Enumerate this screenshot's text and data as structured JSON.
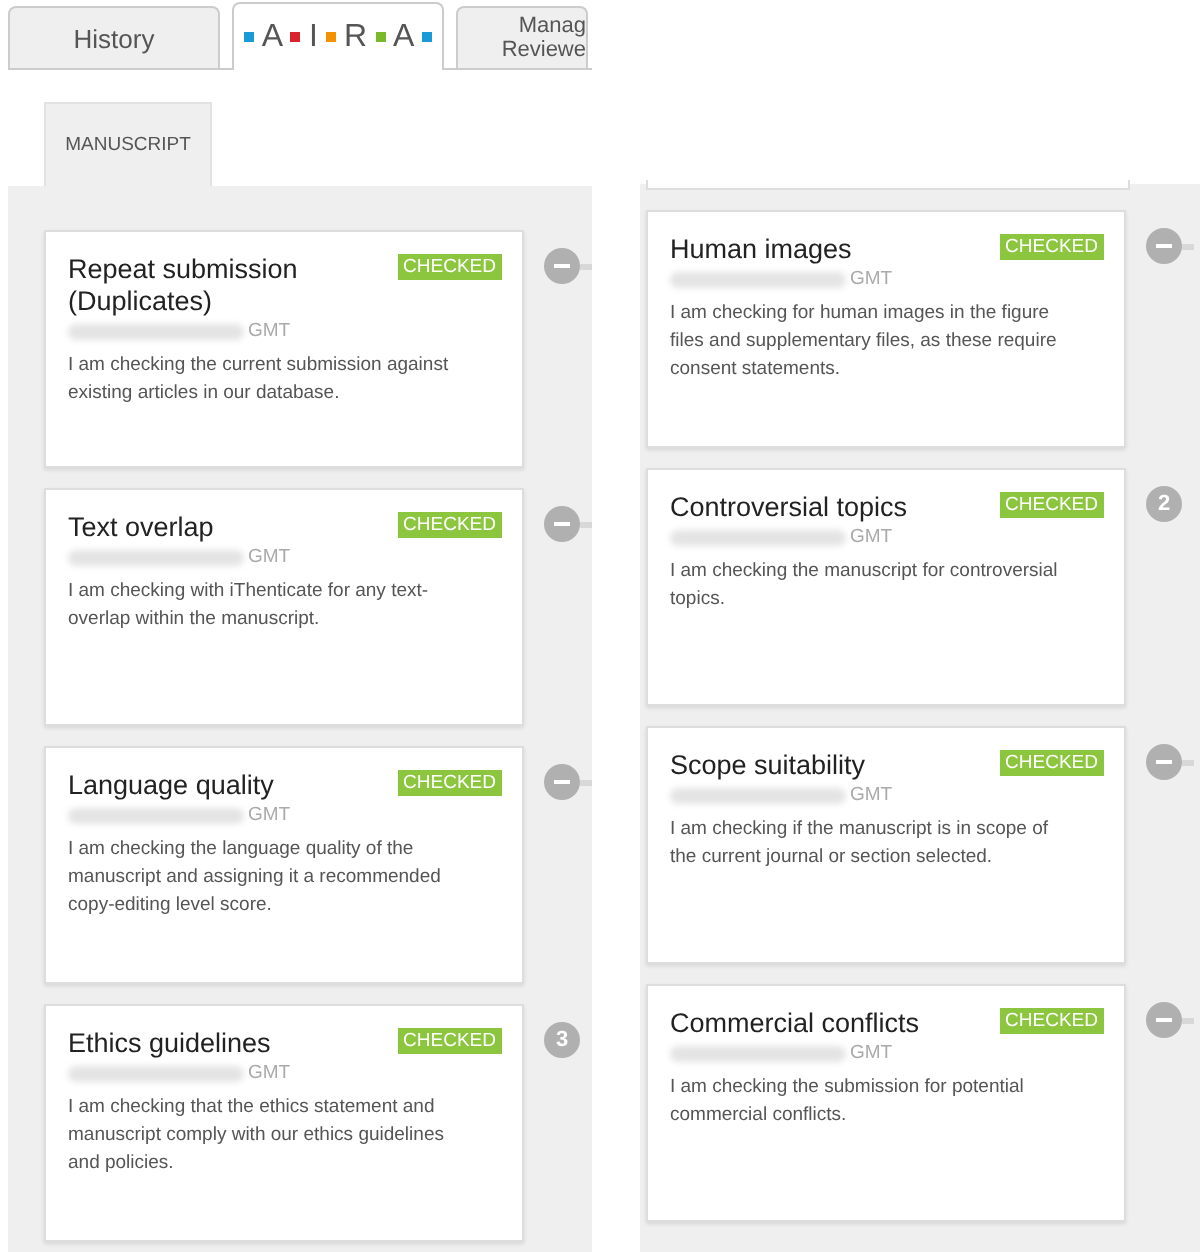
{
  "tabs": [
    {
      "kind": "text",
      "lines": [
        "History"
      ],
      "selected": false
    },
    {
      "kind": "logo",
      "letters": [
        "A",
        "I",
        "R",
        "A"
      ],
      "dots": [
        {
          "color": "#1a9ad6"
        },
        {
          "color": "#d9232e"
        },
        {
          "color": "#f39200"
        },
        {
          "color": "#7ab929"
        },
        {
          "color": "#1a9ad6"
        }
      ],
      "selected": true
    },
    {
      "kind": "text",
      "lines": [
        "Manag",
        "Reviewe"
      ],
      "selected": false
    }
  ],
  "subtabs": [
    {
      "label": "MANUSCRIPT",
      "selected": true
    }
  ],
  "columns": [
    {
      "checks": [
        {
          "title": "Repeat submission (Duplicates)",
          "status": "CHECKED",
          "time": "GMT",
          "description": "I am checking the current submission against existing articles in our database.",
          "marker": {
            "kind": "minus"
          }
        },
        {
          "title": "Text overlap",
          "status": "CHECKED",
          "time": "GMT",
          "description": "I am checking with iThenticate for any text-overlap within the manuscript.",
          "marker": {
            "kind": "minus"
          }
        },
        {
          "title": "Language quality",
          "status": "CHECKED",
          "time": "GMT",
          "description": "I am checking the language quality of the manuscript and assigning it a recommended copy-editing level score.",
          "marker": {
            "kind": "minus"
          }
        },
        {
          "title": "Ethics guidelines",
          "status": "CHECKED",
          "time": "GMT",
          "description": "I am checking that the ethics statement and manuscript comply with our ethics guidelines and policies.",
          "marker": {
            "kind": "count",
            "text": "3"
          }
        }
      ]
    },
    {
      "checks": [
        {
          "title": "Human images",
          "status": "CHECKED",
          "time": "GMT",
          "description": "I am checking for human images in the figure files and supplementary files, as these require consent statements.",
          "marker": {
            "kind": "minus"
          }
        },
        {
          "title": "Controversial topics",
          "status": "CHECKED",
          "time": "GMT",
          "description": "I am checking the manuscript for controversial topics.",
          "marker": {
            "kind": "count",
            "text": "2"
          }
        },
        {
          "title": "Scope suitability",
          "status": "CHECKED",
          "time": "GMT",
          "description": "I am checking if the manuscript is in scope of the current journal or section selected.",
          "marker": {
            "kind": "minus"
          }
        },
        {
          "title": "Commercial conflicts",
          "status": "CHECKED",
          "time": "GMT",
          "description": "I am checking the submission for potential commercial conflicts.",
          "marker": {
            "kind": "minus"
          }
        }
      ]
    }
  ]
}
